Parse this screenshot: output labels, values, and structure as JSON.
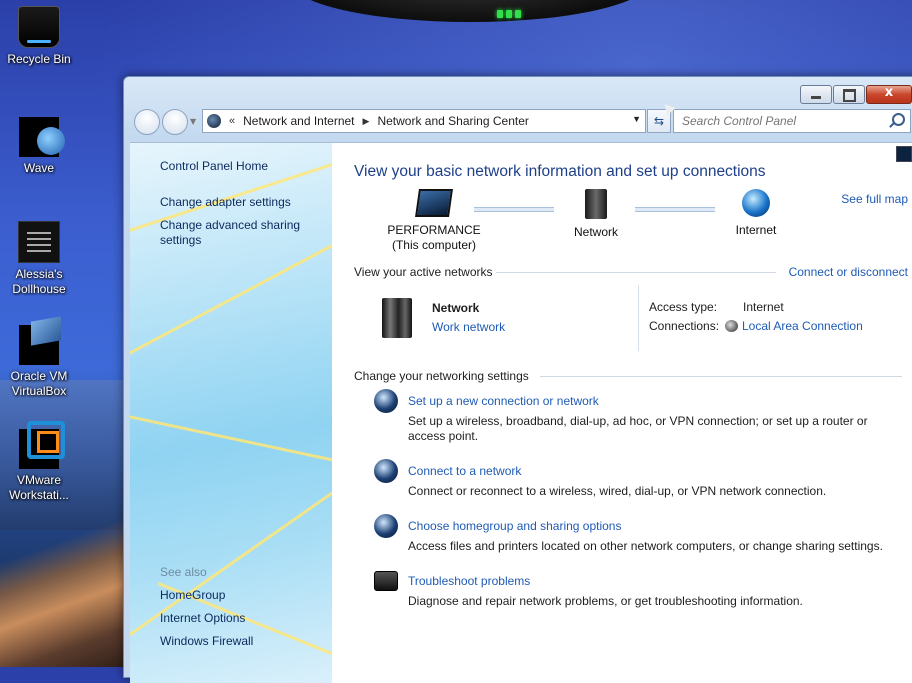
{
  "desktop": {
    "icons": [
      {
        "label": "Recycle Bin"
      },
      {
        "label": "Wave"
      },
      {
        "label": "Alessia's Dollhouse"
      },
      {
        "label": "Oracle VM VirtualBox"
      },
      {
        "label": "VMware Workstati..."
      }
    ]
  },
  "window": {
    "breadcrumb": [
      "Network and Internet",
      "Network and Sharing Center"
    ],
    "breadcrumb_prefix": "«",
    "search_placeholder": "Search Control Panel",
    "close_glyph": "x"
  },
  "left_pane": {
    "links": [
      "Control Panel Home",
      "Change adapter settings",
      "Change advanced sharing settings"
    ],
    "see_also_label": "See also",
    "see_also": [
      "HomeGroup",
      "Internet Options",
      "Windows Firewall"
    ]
  },
  "main": {
    "heading": "View your basic network information and set up connections",
    "see_full_map": "See full map",
    "map": {
      "computer_name": "PERFORMANCE",
      "computer_sub": "(This computer)",
      "network": "Network",
      "internet": "Internet"
    },
    "active_networks_label": "View your active networks",
    "connect_disconnect": "Connect or disconnect",
    "active_network": {
      "name": "Network",
      "type_link": "Work network",
      "access_type_label": "Access type:",
      "access_type_value": "Internet",
      "connections_label": "Connections:",
      "connections_value": "Local Area Connection"
    },
    "settings_label": "Change your networking settings",
    "tasks": [
      {
        "title": "Set up a new connection or network",
        "desc": "Set up a wireless, broadband, dial-up, ad hoc, or VPN connection; or set up a router or access point."
      },
      {
        "title": "Connect to a network",
        "desc": "Connect or reconnect to a wireless, wired, dial-up, or VPN network connection."
      },
      {
        "title": "Choose homegroup and sharing options",
        "desc": "Access files and printers located on other network computers, or change sharing settings."
      },
      {
        "title": "Troubleshoot problems",
        "desc": "Diagnose and repair network problems, or get troubleshooting information."
      }
    ]
  }
}
